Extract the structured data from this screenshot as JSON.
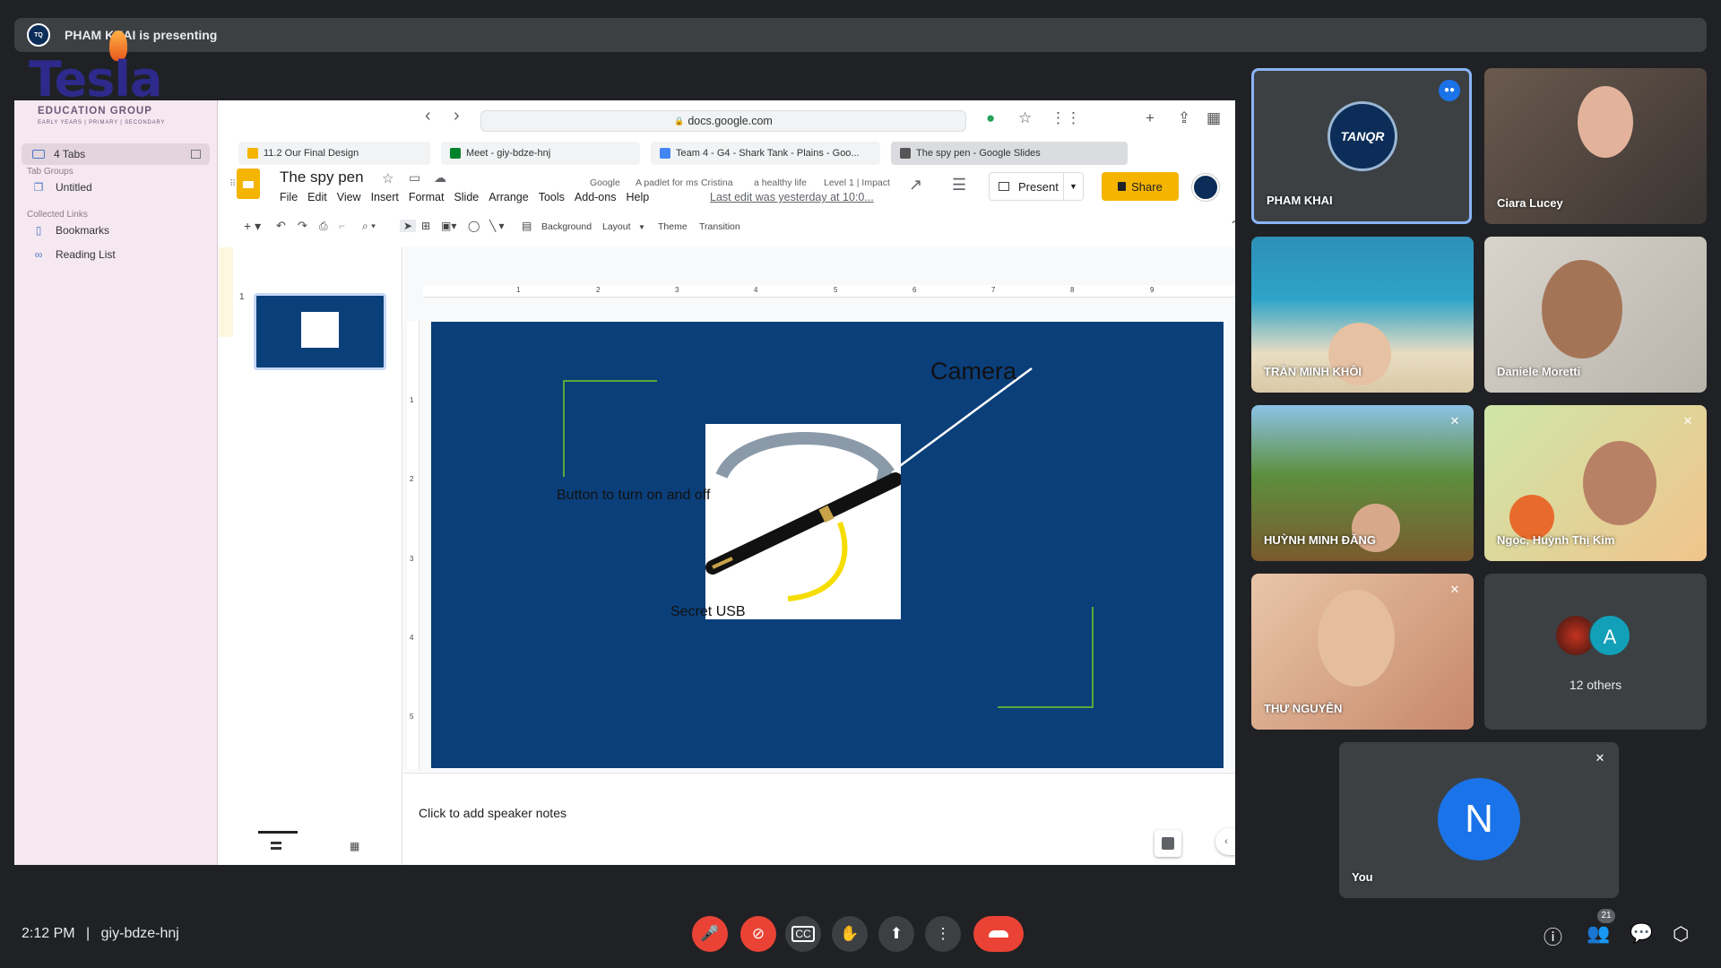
{
  "presenting": {
    "text": "PHAM KHAI is presenting",
    "logo_icon": "tanqr-logo-icon"
  },
  "logo": {
    "word": "Tesla",
    "group": "EDUCATION GROUP",
    "tagline": "EARLY YEARS  |  PRIMARY  |  SECONDARY",
    "color": "#2d2a8c"
  },
  "sidebar": {
    "tabs_label": "4 Tabs",
    "tab_groups_header": "Tab Groups",
    "untitled": "Untitled",
    "collected_links_header": "Collected Links",
    "bookmarks": "Bookmarks",
    "reading_list": "Reading List"
  },
  "browser": {
    "url": "docs.google.com",
    "tabs": [
      {
        "label": "11.2 Our Final Design"
      },
      {
        "label": "Meet - giy-bdze-hnj"
      },
      {
        "label": "Team 4 - G4 - Shark Tank - Plains - Goo..."
      },
      {
        "label": "The spy pen - Google Slides"
      }
    ],
    "bookmarks": [
      "Google",
      "A padlet for ms Cristina",
      "a healthy life",
      "Level 1 | Impact"
    ]
  },
  "slides": {
    "title": "The spy pen",
    "menu": [
      "File",
      "Edit",
      "View",
      "Insert",
      "Format",
      "Slide",
      "Arrange",
      "Tools",
      "Add-ons",
      "Help"
    ],
    "last_edit": "Last edit was yesterday at 10:0...",
    "present_label": "Present",
    "share_label": "Share",
    "toolbar": {
      "background": "Background",
      "layout": "Layout",
      "theme": "Theme",
      "transition": "Transition"
    },
    "slide_number": "1",
    "ruler_h": [
      "1",
      "2",
      "3",
      "4",
      "5",
      "6",
      "7",
      "8",
      "9"
    ],
    "ruler_v": [
      "1",
      "2",
      "3",
      "4",
      "5"
    ],
    "slide": {
      "camera": "Camera",
      "button_text": "Button to turn on and off",
      "usb": "Secret USB",
      "background_color": "#0b3f7a"
    },
    "notes_placeholder": "Click to add speaker notes"
  },
  "participants": [
    {
      "name": "PHAM KHAI",
      "speaking": true
    },
    {
      "name": "Ciara Lucey"
    },
    {
      "name": "TRẦN MINH KHÔI"
    },
    {
      "name": "Daniele Moretti"
    },
    {
      "name": "HUỲNH MINH ĐĂNG",
      "muted": true
    },
    {
      "name": "Ngọc, Huỳnh Thị Kim",
      "muted": true
    },
    {
      "name": "THƯ NGUYỄN",
      "muted": true
    },
    {
      "name": "12 others"
    },
    {
      "name": "You",
      "initial": "N",
      "muted": true
    }
  ],
  "others_initial": "A",
  "meeting": {
    "time": "2:12 PM",
    "separator": "|",
    "code": "giy-bdze-hnj",
    "people_count": "21"
  }
}
